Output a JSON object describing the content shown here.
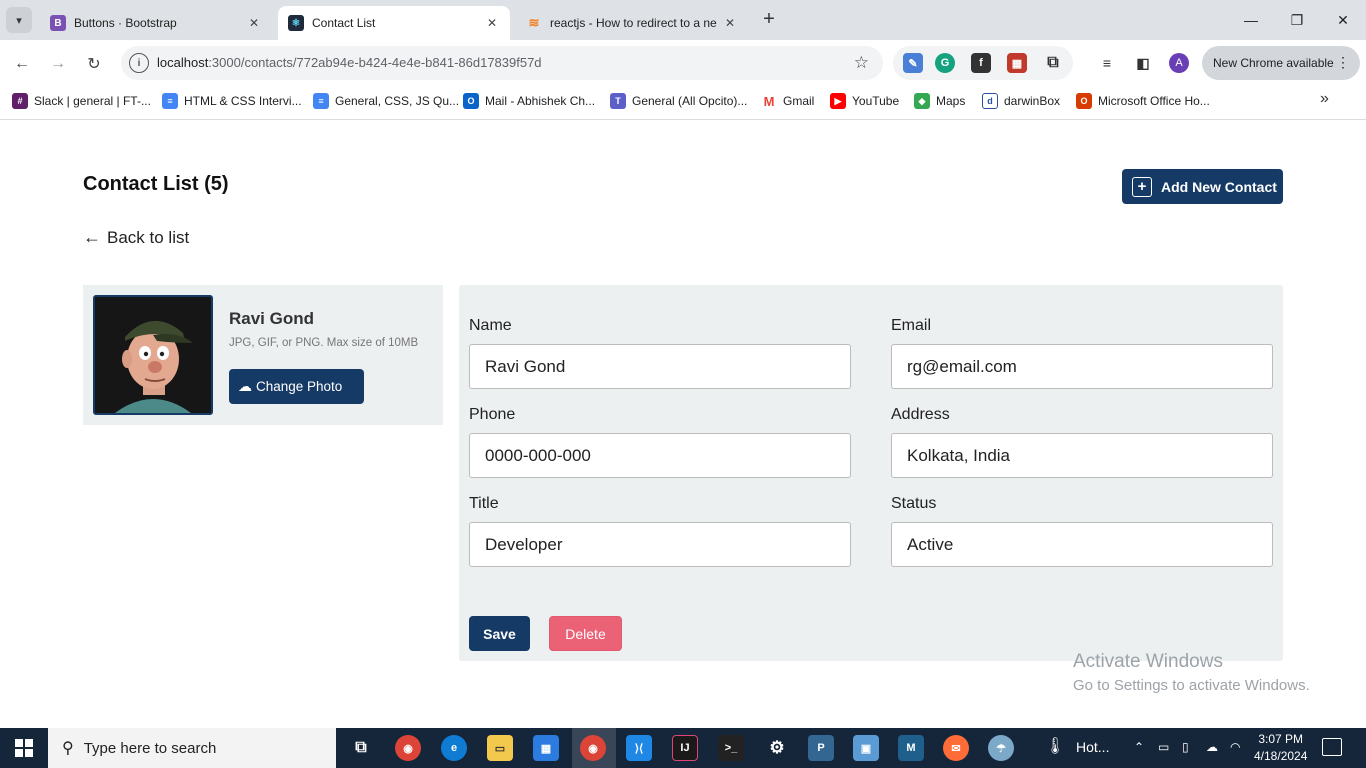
{
  "browser": {
    "tabs": [
      {
        "title": "Buttons · Bootstrap",
        "icon": "bootstrap-icon",
        "active": false
      },
      {
        "title": "Contact List",
        "icon": "react-icon",
        "active": true
      },
      {
        "title": "reactjs - How to redirect to a ne",
        "icon": "stackoverflow-icon",
        "active": false
      }
    ],
    "url_host": "localhost",
    "url_path": ":3000/contacts/772ab94e-b424-4e4e-b841-86d17839f57d",
    "avatar_letter": "A",
    "update_label": "New Chrome available",
    "bookmarks": [
      {
        "label": "Slack | general | FT-...",
        "icon": "slack-icon"
      },
      {
        "label": "HTML & CSS Intervi...",
        "icon": "docs-icon"
      },
      {
        "label": "General, CSS, JS Qu...",
        "icon": "docs-icon"
      },
      {
        "label": "Mail - Abhishek Ch...",
        "icon": "outlook-icon"
      },
      {
        "label": "General (All Opcito)...",
        "icon": "teams-icon"
      },
      {
        "label": "Gmail",
        "icon": "gmail-icon"
      },
      {
        "label": "YouTube",
        "icon": "youtube-icon"
      },
      {
        "label": "Maps",
        "icon": "maps-icon"
      },
      {
        "label": "darwinBox",
        "icon": "darwinbox-icon"
      },
      {
        "label": "Microsoft Office Ho...",
        "icon": "office-icon"
      }
    ]
  },
  "page": {
    "title": "Contact List (5)",
    "add_button": "Add New Contact",
    "back_link": "Back to list"
  },
  "contact": {
    "name": "Ravi Gond",
    "photo_hint": "JPG, GIF, or PNG. Max size of 10MB",
    "change_photo": "Change Photo"
  },
  "form": {
    "fields": [
      {
        "label": "Name",
        "value": "Ravi Gond"
      },
      {
        "label": "Email",
        "value": "rg@email.com"
      },
      {
        "label": "Phone",
        "value": "0000-000-000"
      },
      {
        "label": "Address",
        "value": "Kolkata, India"
      },
      {
        "label": "Title",
        "value": "Developer"
      },
      {
        "label": "Status",
        "value": "Active"
      }
    ],
    "save": "Save",
    "delete": "Delete"
  },
  "watermark": {
    "line1": "Activate Windows",
    "line2": "Go to Settings to activate Windows."
  },
  "taskbar": {
    "search_placeholder": "Type here to search",
    "weather": "Hot...",
    "time": "3:07 PM",
    "date": "4/18/2024"
  },
  "colors": {
    "primary": "#153a66",
    "danger": "#eb6277",
    "card_bg": "#ecf0f1"
  }
}
